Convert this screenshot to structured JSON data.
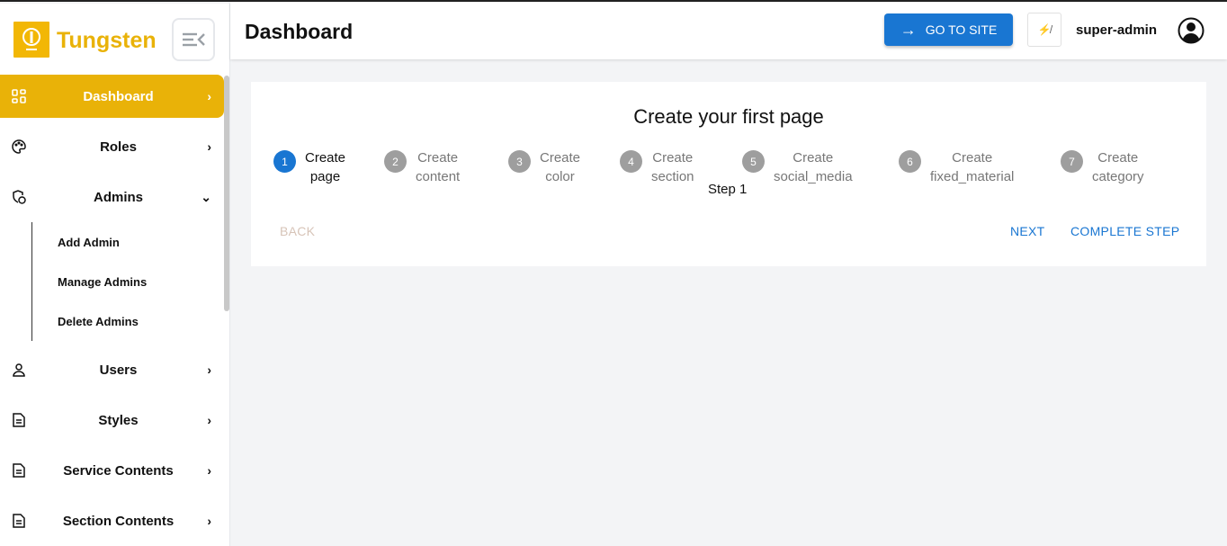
{
  "brand": {
    "name": "Tungsten"
  },
  "sidebar": {
    "items": [
      {
        "label": "Dashboard",
        "icon": "dashboard-icon",
        "active": true
      },
      {
        "label": "Roles",
        "icon": "palette-icon"
      },
      {
        "label": "Admins",
        "icon": "admin-shield-icon",
        "expanded": true
      },
      {
        "label": "Users",
        "icon": "user-icon"
      },
      {
        "label": "Styles",
        "icon": "document-icon"
      },
      {
        "label": "Service Contents",
        "icon": "document-icon"
      },
      {
        "label": "Section Contents",
        "icon": "document-icon"
      }
    ],
    "admin_sub": [
      "Add Admin",
      "Manage Admins",
      "Delete Admins"
    ]
  },
  "header": {
    "title": "Dashboard",
    "go_to_site": "GO TO SITE",
    "user": "super-admin"
  },
  "stepper": {
    "title": "Create your first page",
    "current_step_text": "Step 1",
    "steps": [
      {
        "n": "1",
        "l1": "Create",
        "l2": "page"
      },
      {
        "n": "2",
        "l1": "Create",
        "l2": "content"
      },
      {
        "n": "3",
        "l1": "Create",
        "l2": "color"
      },
      {
        "n": "4",
        "l1": "Create",
        "l2": "section"
      },
      {
        "n": "5",
        "l1": "Create",
        "l2": "social_media"
      },
      {
        "n": "6",
        "l1": "Create",
        "l2": "fixed_material"
      },
      {
        "n": "7",
        "l1": "Create",
        "l2": "category"
      }
    ],
    "back": "BACK",
    "next": "NEXT",
    "complete": "COMPLETE STEP"
  },
  "colors": {
    "accent": "#e9b208",
    "primary": "#1976d2"
  }
}
